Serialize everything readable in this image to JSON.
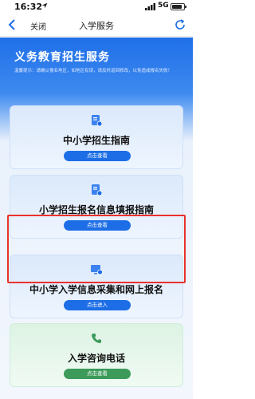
{
  "status_bar": {
    "time": "16:32",
    "network": "5G"
  },
  "nav": {
    "close_label": "关闭",
    "title": "入学服务"
  },
  "banner": {
    "title": "义务教育招生服务",
    "notice": "温馨提示：请确认报名地区，如地区有误，请及时返回修改，以免造成报名失败！"
  },
  "cards": [
    {
      "title": "中小学招生指南",
      "button": "点击查看",
      "icon": "document-check-icon"
    },
    {
      "title": "小学招生报名信息填报指南",
      "button": "点击查看",
      "icon": "document-gear-icon"
    },
    {
      "title": "中小学入学信息采集和网上报名",
      "button": "点击进入",
      "icon": "monitor-check-icon"
    },
    {
      "title": "入学咨询电话",
      "button": "点击查看",
      "icon": "phone-icon"
    }
  ],
  "colors": {
    "primary": "#1d6ee6",
    "highlight": "#e8322c",
    "green": "#3c9a5a"
  }
}
